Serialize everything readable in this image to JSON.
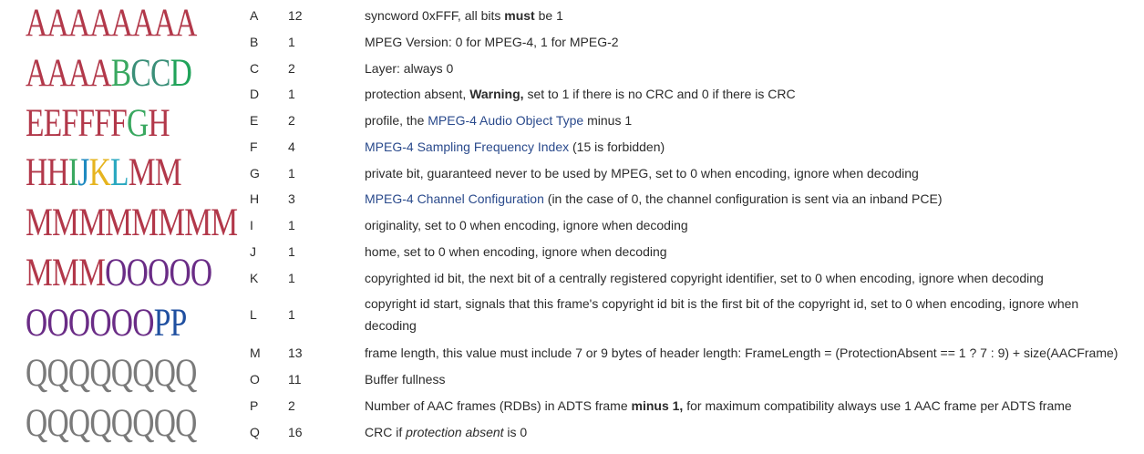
{
  "colors": {
    "A": "#b2384a",
    "B": "#3aa860",
    "C": "#3a8f78",
    "D": "#21a35a",
    "E": "#b2384a",
    "F": "#b2384a",
    "G": "#3aa860",
    "H": "#b2384a",
    "I": "#3aa860",
    "J": "#1f8ac0",
    "K": "#e6b41f",
    "L": "#2aa8c0",
    "M": "#b2384a",
    "O": "#6a2c86",
    "P": "#1f4fa0",
    "Q": "#7a7a7a",
    "link": "#2a4a8c",
    "text": "#2b2b2b"
  },
  "bit_rows": [
    "AAAAAAAA",
    "AAAABCCD",
    "EEFFFFGH",
    "HHIJKLMM",
    "MMMMMMMM",
    "MMMOOOOO",
    "OOOOOOPP",
    "QQQQQQQQ",
    "QQQQQQQQ"
  ],
  "fields": [
    {
      "letter": "A",
      "length": "12",
      "desc": [
        {
          "t": "syncword 0xFFF, all bits "
        },
        {
          "t": "must",
          "b": true
        },
        {
          "t": " be 1"
        }
      ]
    },
    {
      "letter": "B",
      "length": "1",
      "desc": [
        {
          "t": "MPEG Version: 0 for MPEG-4, 1 for MPEG-2"
        }
      ]
    },
    {
      "letter": "C",
      "length": "2",
      "desc": [
        {
          "t": "Layer: always 0"
        }
      ]
    },
    {
      "letter": "D",
      "length": "1",
      "desc": [
        {
          "t": "protection absent, "
        },
        {
          "t": "Warning,",
          "b": true
        },
        {
          "t": " set to 1 if there is no CRC and 0 if there is CRC"
        }
      ]
    },
    {
      "letter": "E",
      "length": "2",
      "desc": [
        {
          "t": "profile, the "
        },
        {
          "t": "MPEG-4 Audio Object Type",
          "link": true
        },
        {
          "t": " minus 1"
        }
      ]
    },
    {
      "letter": "F",
      "length": "4",
      "desc": [
        {
          "t": "MPEG-4 Sampling Frequency Index",
          "link": true
        },
        {
          "t": " (15 is forbidden)"
        }
      ]
    },
    {
      "letter": "G",
      "length": "1",
      "desc": [
        {
          "t": "private bit, guaranteed never to be used by MPEG, set to 0 when encoding, ignore when decoding"
        }
      ]
    },
    {
      "letter": "H",
      "length": "3",
      "desc": [
        {
          "t": "MPEG-4 Channel Configuration",
          "link": true
        },
        {
          "t": " (in the case of 0, the channel configuration is sent via an inband PCE)"
        }
      ]
    },
    {
      "letter": "I",
      "length": "1",
      "desc": [
        {
          "t": "originality, set to 0 when encoding, ignore when decoding"
        }
      ]
    },
    {
      "letter": "J",
      "length": "1",
      "desc": [
        {
          "t": "home, set to 0 when encoding, ignore when decoding"
        }
      ]
    },
    {
      "letter": "K",
      "length": "1",
      "desc": [
        {
          "t": "copyrighted id bit, the next bit of a centrally registered copyright identifier, set to 0 when encoding, ignore when decoding"
        }
      ]
    },
    {
      "letter": "L",
      "length": "1",
      "tall": true,
      "desc": [
        {
          "t": "copyright id start, signals that this frame's copyright id bit is the first bit of the copyright id, set to 0 when encoding, ignore when decoding"
        }
      ]
    },
    {
      "letter": "M",
      "length": "13",
      "desc": [
        {
          "t": "frame length, this value must include 7 or 9 bytes of header length: FrameLength = (ProtectionAbsent == 1 ? 7 : 9) + size(AACFrame)"
        }
      ]
    },
    {
      "letter": "O",
      "length": "11",
      "desc": [
        {
          "t": "Buffer fullness"
        }
      ]
    },
    {
      "letter": "P",
      "length": "2",
      "desc": [
        {
          "t": "Number of AAC frames (RDBs) in ADTS frame "
        },
        {
          "t": "minus 1,",
          "b": true
        },
        {
          "t": " for maximum compatibility always use 1 AAC frame per ADTS frame"
        }
      ]
    },
    {
      "letter": "Q",
      "length": "16",
      "desc": [
        {
          "t": "CRC if "
        },
        {
          "t": "protection absent",
          "i": true
        },
        {
          "t": " is 0"
        }
      ]
    }
  ]
}
